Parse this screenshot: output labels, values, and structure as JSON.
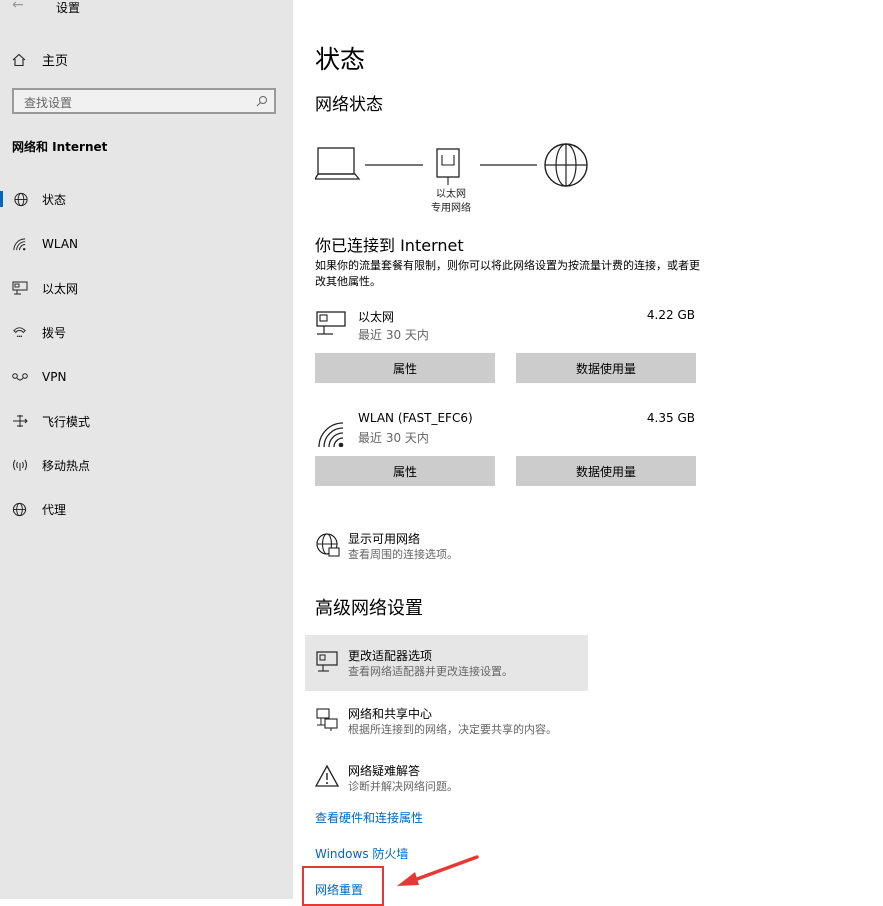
{
  "app": {
    "title": "设置",
    "back_glyph": "←"
  },
  "sidebar": {
    "home_label": "主页",
    "search_placeholder": "查找设置",
    "section_title": "网络和 Internet",
    "items": [
      {
        "label": "状态",
        "icon": "globe-icon",
        "active": true
      },
      {
        "label": "WLAN",
        "icon": "wifi-icon"
      },
      {
        "label": "以太网",
        "icon": "ethernet-icon"
      },
      {
        "label": "拨号",
        "icon": "phone-icon"
      },
      {
        "label": "VPN",
        "icon": "vpn-icon"
      },
      {
        "label": "飞行模式",
        "icon": "airplane-icon"
      },
      {
        "label": "移动热点",
        "icon": "hotspot-icon"
      },
      {
        "label": "代理",
        "icon": "globe-icon"
      }
    ]
  },
  "main": {
    "title": "状态",
    "network_status_title": "网络状态",
    "diagram_caption_line1": "以太网",
    "diagram_caption_line2": "专用网络",
    "connected_title": "你已连接到 Internet",
    "connected_desc": "如果你的流量套餐有限制，则你可以将此网络设置为按流量计费的连接，或者更改其他属性。",
    "connections": [
      {
        "name": "以太网",
        "sub": "最近 30 天内",
        "size": "4.22 GB",
        "btn_props": "属性",
        "btn_usage": "数据使用量"
      },
      {
        "name": "WLAN (FAST_EFC6)",
        "sub": "最近 30 天内",
        "size": "4.35 GB",
        "btn_props": "属性",
        "btn_usage": "数据使用量"
      }
    ],
    "show_networks": {
      "title": "显示可用网络",
      "sub": "查看周围的连接选项。"
    },
    "advanced_title": "高级网络设置",
    "advanced": [
      {
        "title": "更改适配器选项",
        "sub": "查看网络适配器并更改连接设置。"
      },
      {
        "title": "网络和共享中心",
        "sub": "根据所连接到的网络，决定要共享的内容。"
      },
      {
        "title": "网络疑难解答",
        "sub": "诊断并解决网络问题。"
      }
    ],
    "links": {
      "hardware": "查看硬件和连接属性",
      "firewall": "Windows 防火墙",
      "reset": "网络重置"
    }
  },
  "colors": {
    "accent": "#0067c0",
    "highlight": "#e53935",
    "sidebar_bg": "#e6e6e6",
    "button_bg": "#cccccc"
  }
}
